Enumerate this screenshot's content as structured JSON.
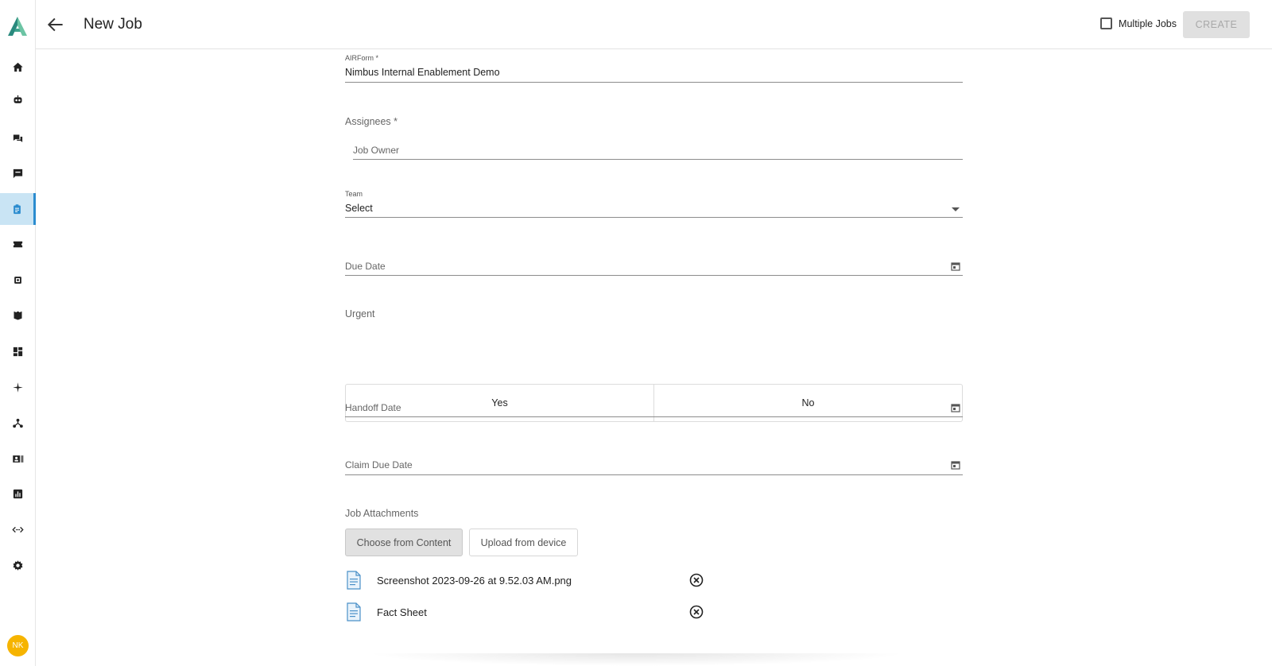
{
  "header": {
    "title": "New Job",
    "multiple_jobs_label": "Multiple Jobs",
    "create_label": "CREATE"
  },
  "sidebar": {
    "items": [
      {
        "icon": "home-icon",
        "active": false
      },
      {
        "icon": "robot-icon",
        "active": false
      },
      {
        "icon": "chat-bubbles-icon",
        "active": false
      },
      {
        "icon": "message-icon",
        "active": false
      },
      {
        "icon": "clipboard-icon",
        "active": true
      },
      {
        "icon": "ticket-icon",
        "active": false
      },
      {
        "icon": "chip-icon",
        "active": false
      },
      {
        "icon": "book-icon",
        "active": false
      },
      {
        "icon": "dashboard-icon",
        "active": false
      },
      {
        "icon": "sparkle-icon",
        "active": false
      },
      {
        "icon": "hub-icon",
        "active": false
      },
      {
        "icon": "contact-card-icon",
        "active": false
      },
      {
        "icon": "analytics-icon",
        "active": false
      },
      {
        "icon": "code-icon",
        "active": false
      },
      {
        "icon": "settings-icon",
        "active": false
      }
    ],
    "avatar_initials": "NK",
    "accent_color": "#2b8ccf"
  },
  "form": {
    "airform": {
      "label": "AIRForm *",
      "value": "Nimbus Internal Enablement Demo"
    },
    "assignees": {
      "label": "Assignees *",
      "placeholder": "Job Owner"
    },
    "team": {
      "label": "Team",
      "value": "Select"
    },
    "due_date": {
      "placeholder": "Due Date"
    },
    "urgent": {
      "label": "Urgent",
      "options": [
        "Yes",
        "No"
      ]
    },
    "handoff_date": {
      "placeholder": "Handoff Date"
    },
    "claim_due_date": {
      "placeholder": "Claim Due Date"
    },
    "attachments": {
      "label": "Job Attachments",
      "choose_label": "Choose from Content",
      "upload_label": "Upload from device",
      "files": [
        {
          "name": "Screenshot 2023-09-26 at 9.52.03 AM.png"
        },
        {
          "name": "Fact Sheet"
        }
      ]
    }
  }
}
